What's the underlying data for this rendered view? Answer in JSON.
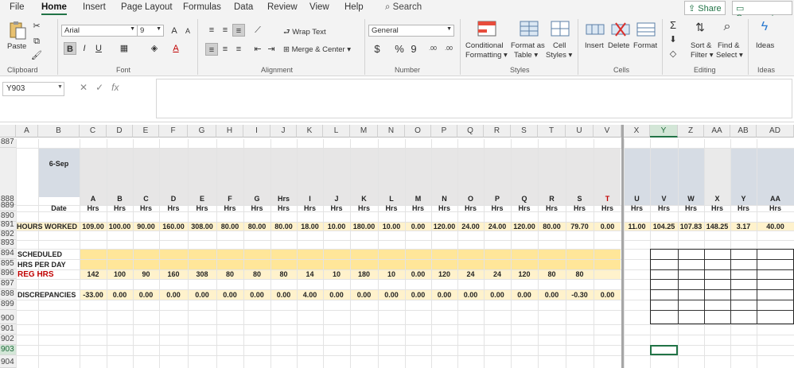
{
  "menu": {
    "items": [
      "File",
      "Home",
      "Insert",
      "Page Layout",
      "Formulas",
      "Data",
      "Review",
      "View",
      "Help"
    ],
    "active": "Home",
    "search_label": "Search",
    "share_label": "Share",
    "comments_label": "Comments"
  },
  "ribbon": {
    "clipboard": {
      "paste": "Paste",
      "label": "Clipboard"
    },
    "font": {
      "name": "Arial",
      "size": "9",
      "grow": "A",
      "shrink": "A",
      "bold": "B",
      "italic": "I",
      "underline": "U",
      "font_color_letter": "A",
      "label": "Font"
    },
    "alignment": {
      "wrap_text": "Wrap Text",
      "merge_center": "Merge & Center",
      "label": "Alignment"
    },
    "number": {
      "format": "General",
      "currency": "$",
      "percent": "%",
      "comma": "9",
      "inc_dec": ".00",
      "dec_dec": ".00",
      "label": "Number"
    },
    "styles": {
      "conditional": "Conditional",
      "formatting": "Formatting",
      "format_as": "Format as",
      "table": "Table",
      "cell": "Cell",
      "styles": "Styles",
      "label": "Styles"
    },
    "cells": {
      "insert": "Insert",
      "delete": "Delete",
      "format": "Format",
      "label": "Cells"
    },
    "editing": {
      "sort_filter_1": "Sort &",
      "sort_filter_2": "Filter",
      "find_select_1": "Find &",
      "find_select_2": "Select",
      "label": "Editing"
    },
    "ideas": {
      "ideas": "Ideas",
      "label": "Ideas"
    }
  },
  "formula_bar": {
    "name_box": "Y903",
    "fx": "fx",
    "content": ""
  },
  "colors": {
    "accent": "#217346",
    "header_red": "#c00000",
    "yellow": "#ffe699",
    "light_yellow": "#fff2cc",
    "grey_band": "#e7e6e6",
    "blue_band": "#d6dce4"
  },
  "columns": [
    "A",
    "B",
    "C",
    "D",
    "E",
    "F",
    "G",
    "H",
    "I",
    "J",
    "K",
    "L",
    "M",
    "N",
    "O",
    "P",
    "Q",
    "R",
    "S",
    "T",
    "U",
    "V",
    "X",
    "Y",
    "Z",
    "AA",
    "AB",
    "AD"
  ],
  "rows": [
    "887",
    "888",
    "889",
    "890",
    "891",
    "892",
    "893",
    "894",
    "895",
    "896",
    "897",
    "898",
    "899",
    "900",
    "901",
    "902",
    "903",
    "904"
  ],
  "sheet": {
    "date_header": "6-Sep",
    "codes": [
      "A",
      "B",
      "C",
      "D",
      "E",
      "F",
      "G",
      "Hrs",
      "I",
      "J",
      "K",
      "L",
      "M",
      "N",
      "O",
      "P",
      "Q",
      "R",
      "S",
      "T",
      "U",
      "V",
      "W",
      "X",
      "Y",
      "AA"
    ],
    "date_label": "Date",
    "units": [
      "Hrs",
      "Hrs",
      "Hrs",
      "Hrs",
      "Hrs",
      "Hrs",
      "Hrs",
      "Hrs",
      "Hrs",
      "Hrs",
      "Hrs",
      "Hrs",
      "Hrs",
      "Hrs",
      "Hrs",
      "Hrs",
      "Hrs",
      "Hrs",
      "Hrs",
      "Hrs",
      "Hrs",
      "Hrs",
      "Hrs",
      "Hrs",
      "Hrs",
      "Hrs"
    ],
    "hours_worked_label": "HOURS WORKED",
    "hours_worked": [
      "109.00",
      "100.00",
      "90.00",
      "160.00",
      "308.00",
      "80.00",
      "80.00",
      "80.00",
      "18.00",
      "10.00",
      "180.00",
      "10.00",
      "0.00",
      "120.00",
      "24.00",
      "24.00",
      "120.00",
      "80.00",
      "79.70",
      "0.00",
      "11.00",
      "104.25",
      "107.83",
      "148.25",
      "3.17",
      "40.00"
    ],
    "scheduled_label": "SCHEDULED",
    "hrs_per_day_label": "HRS PER DAY",
    "reg_hrs_label": "REG HRS",
    "reg_hrs": [
      "142",
      "100",
      "90",
      "160",
      "308",
      "80",
      "80",
      "80",
      "14",
      "10",
      "180",
      "10",
      "0.00",
      "120",
      "24",
      "24",
      "120",
      "80",
      "80",
      ""
    ],
    "discrepancies_label": "DISCREPANCIES",
    "discrepancies": [
      "-33.00",
      "0.00",
      "0.00",
      "0.00",
      "0.00",
      "0.00",
      "0.00",
      "0.00",
      "4.00",
      "0.00",
      "0.00",
      "0.00",
      "0.00",
      "0.00",
      "0.00",
      "0.00",
      "0.00",
      "0.00",
      "-0.30",
      "0.00"
    ]
  }
}
